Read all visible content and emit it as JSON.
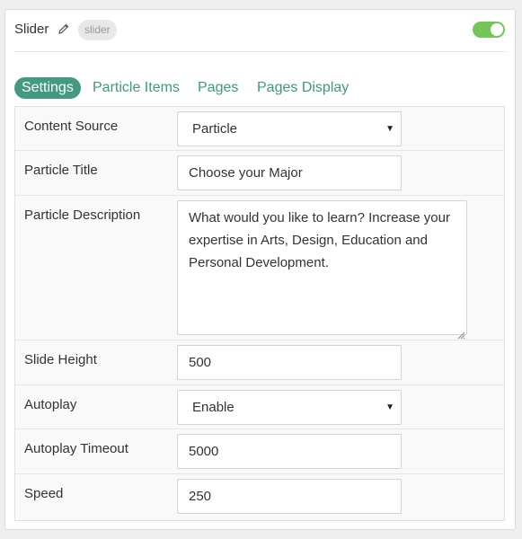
{
  "header": {
    "title": "Slider",
    "badge": "slider",
    "enabled": true,
    "toggle_color": "#73c557"
  },
  "tabs": [
    {
      "label": "Settings",
      "active": true
    },
    {
      "label": "Particle Items",
      "active": false
    },
    {
      "label": "Pages",
      "active": false
    },
    {
      "label": "Pages Display",
      "active": false
    }
  ],
  "accent_color": "#439a80",
  "fields": {
    "content_source": {
      "label": "Content Source",
      "value": "Particle"
    },
    "particle_title": {
      "label": "Particle Title",
      "value": "Choose your Major"
    },
    "particle_description": {
      "label": "Particle Description",
      "value": "What would you like to learn? Increase your expertise in Arts, Design, Education and Personal Development."
    },
    "slide_height": {
      "label": "Slide Height",
      "value": "500"
    },
    "autoplay": {
      "label": "Autoplay",
      "value": "Enable"
    },
    "autoplay_timeout": {
      "label": "Autoplay Timeout",
      "value": "5000"
    },
    "speed": {
      "label": "Speed",
      "value": "250"
    }
  },
  "icons": {
    "edit": "pencil-icon",
    "select_caret": "caret-down-icon",
    "resize": "resize-grip-icon"
  }
}
